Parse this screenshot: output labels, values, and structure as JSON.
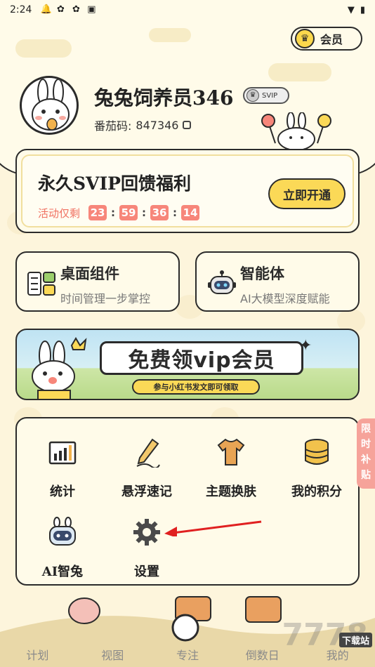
{
  "status_bar": {
    "time": "2:24",
    "battery_icon": "battery-icon",
    "wifi_icon": "wifi-icon"
  },
  "member": {
    "label": "会员"
  },
  "profile": {
    "name": "兔兔饲养员346",
    "badge": "SVIP",
    "uid_label": "番茄码:",
    "uid": "847346"
  },
  "promo": {
    "title": "永久SVIP回馈福利",
    "timer_label": "活动仅剩",
    "timer": [
      "23",
      "59",
      "36",
      "14"
    ],
    "button": "立即开通"
  },
  "features": [
    {
      "title": "桌面组件",
      "subtitle": "时间管理一步掌控"
    },
    {
      "title": "智能体",
      "subtitle": "AI大模型深度赋能"
    }
  ],
  "banner": {
    "title": "免费领vip会员",
    "subtitle": "参与小红书发文即可领取"
  },
  "tools": [
    {
      "label": "统计"
    },
    {
      "label": "悬浮速记"
    },
    {
      "label": "主题换肤"
    },
    {
      "label": "我的积分"
    },
    {
      "label": "AI智兔"
    },
    {
      "label": "设置"
    }
  ],
  "side_tag": "限时补贴",
  "nav": [
    "计划",
    "视图",
    "专注",
    "倒数日",
    "我的"
  ],
  "watermark": {
    "text": "7778",
    "badge": "下载站"
  },
  "colors": {
    "accent": "#fbd957",
    "timer": "#f7867a",
    "background": "#fdf5dc"
  }
}
